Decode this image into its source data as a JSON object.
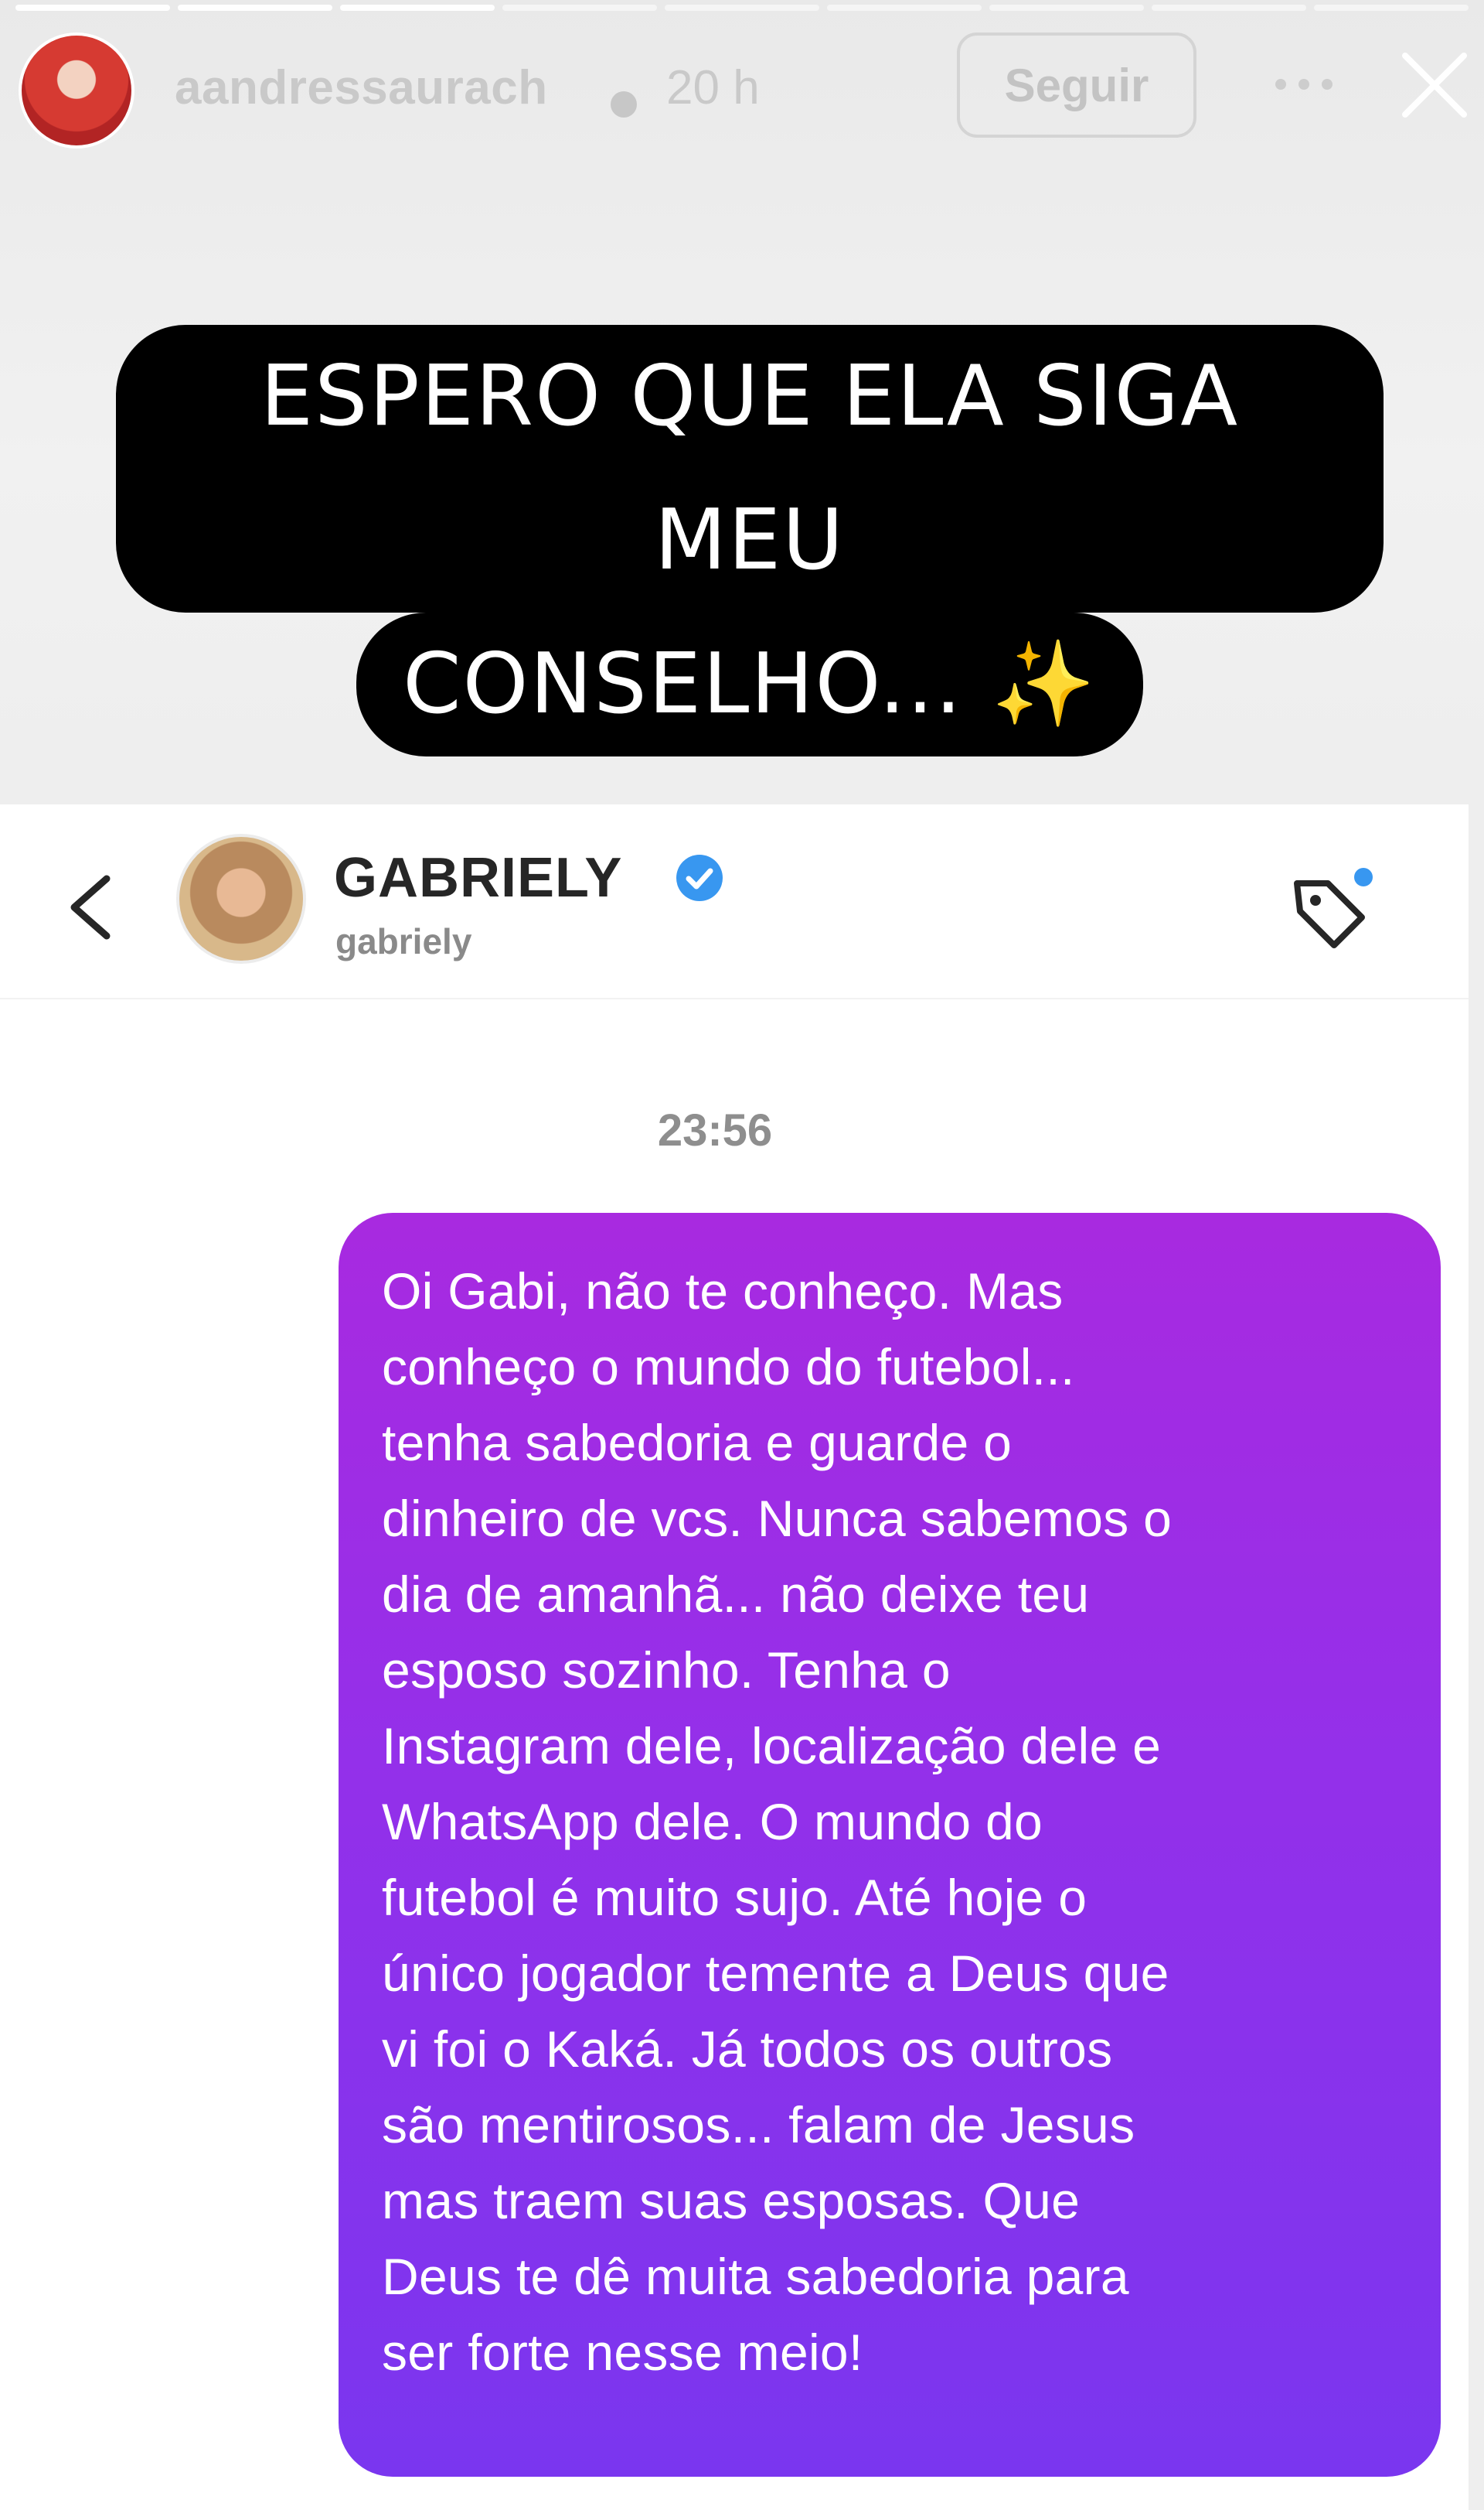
{
  "story": {
    "username": "aandressaurach",
    "time": "20 h",
    "follow_label": "Seguir",
    "caption_line1": "ESPERO QUE ELA SIGA MEU",
    "caption_line2": "CONSELHO...",
    "caption_emoji": "✨"
  },
  "dm": {
    "contact_name": "GABRIELY",
    "contact_handle": "gabriely",
    "timestamp": "23:56",
    "message_lines": [
      "Oi Gabi, não te conheço. Mas",
      "conheço o mundo do futebol...",
      "tenha sabedoria e guarde o",
      "dinheiro de vcs. Nunca sabemos o",
      "dia de amanhã... não deixe teu",
      "esposo sozinho. Tenha o",
      "Instagram dele, localização dele e",
      "WhatsApp dele. O mundo do",
      "futebol é muito sujo. Até hoje o",
      "único jogador temente a Deus que",
      "vi foi o Kaká. Já todos os outros",
      "são mentirosos... falam de Jesus",
      "mas traem suas esposas. Que",
      "Deus te dê muita sabedoria para",
      "ser forte nesse meio!"
    ]
  },
  "icons": {
    "story_avatar": "avatar",
    "verified": "verified-badge-icon",
    "more": "more-options-icon",
    "close": "close-icon",
    "back": "back-chevron-icon",
    "tag": "tag-icon"
  },
  "colors": {
    "bubble_top": "#a82ae0",
    "bubble_bottom": "#7a36ef",
    "verified_blue": "#3897f0",
    "caption_bg": "#000000"
  }
}
